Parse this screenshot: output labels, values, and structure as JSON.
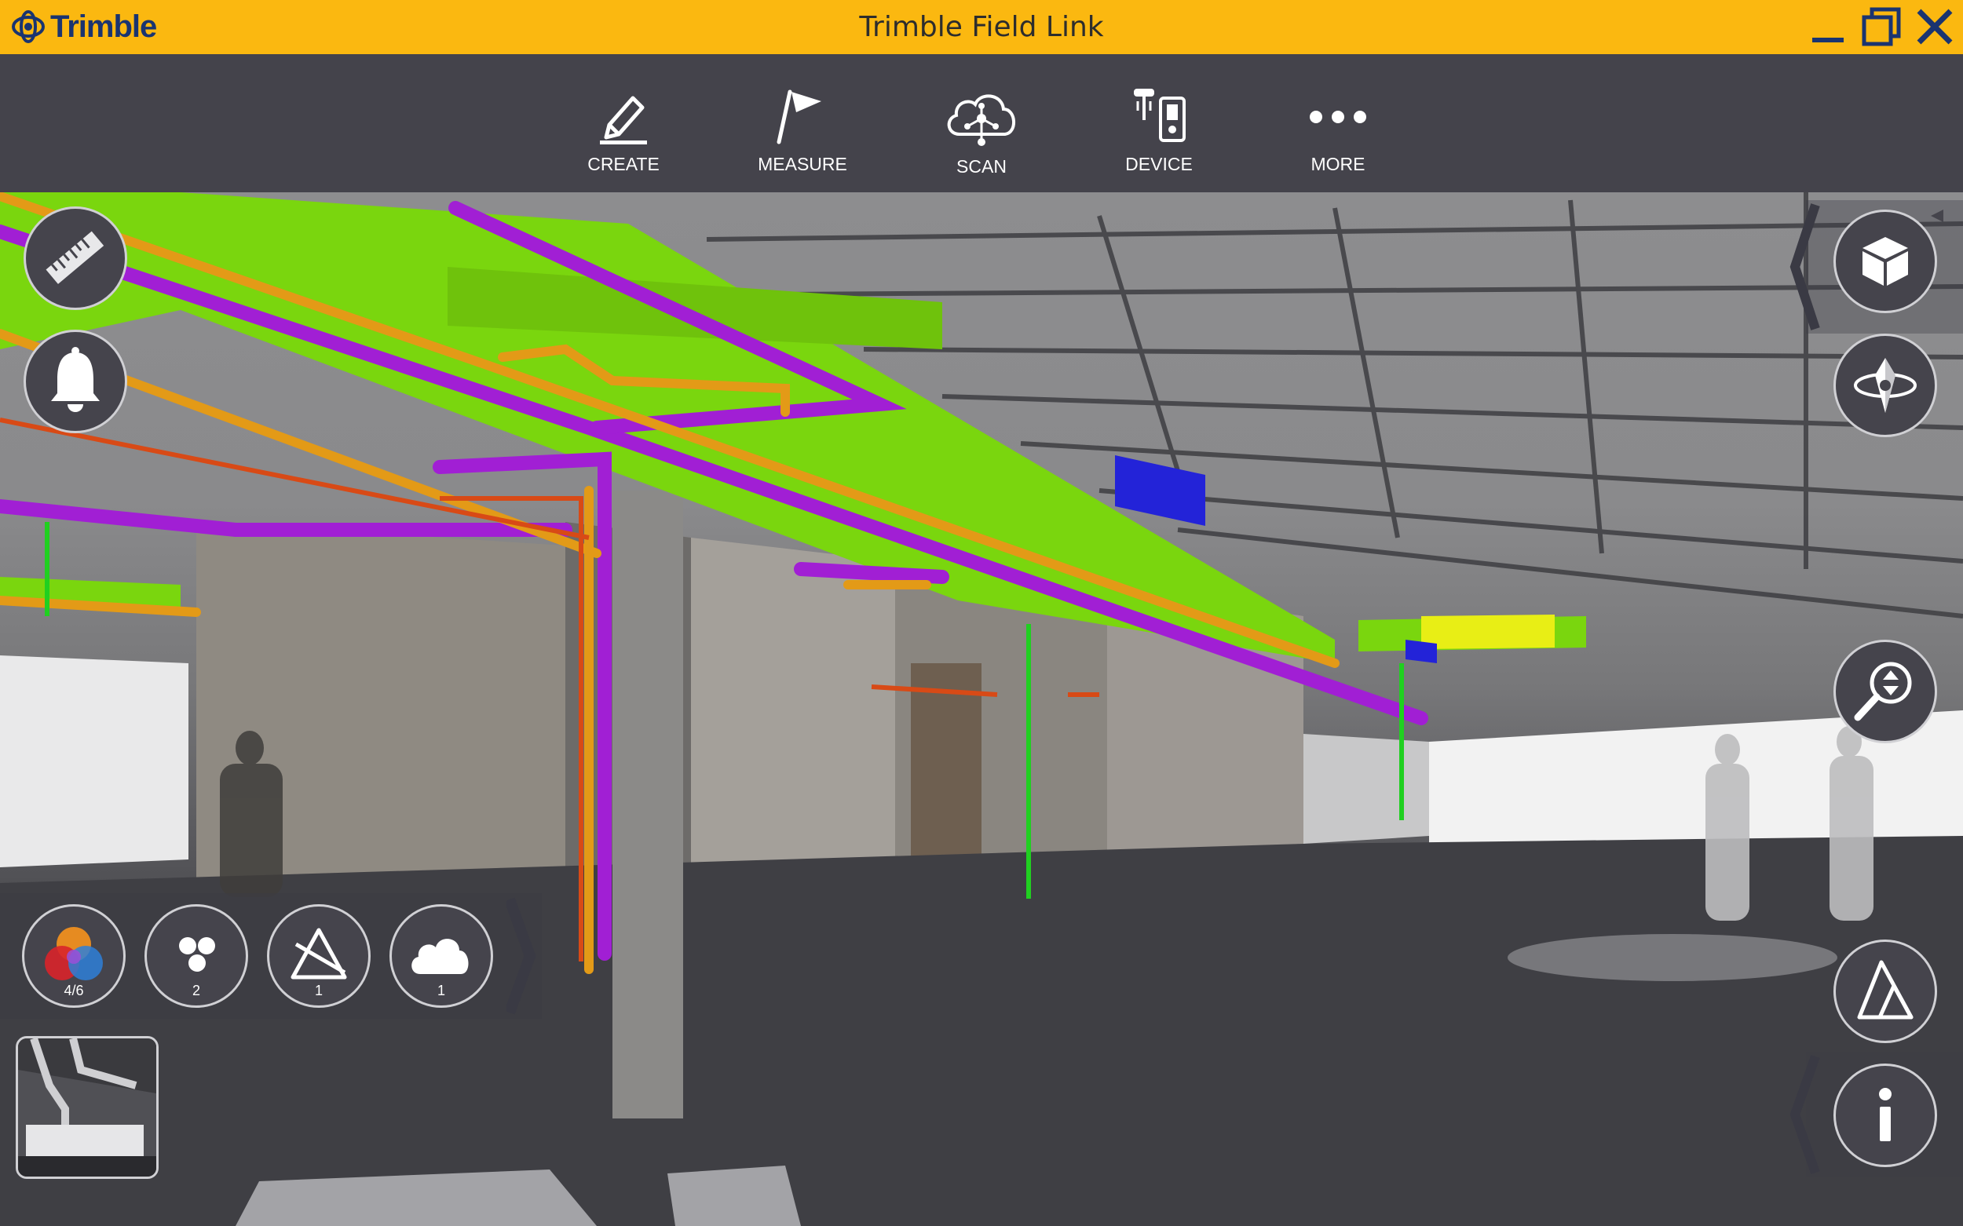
{
  "window": {
    "title": "Trimble Field Link",
    "logo_text": "Trimble",
    "controls": [
      "minimize",
      "maximize",
      "close"
    ]
  },
  "toolbar": {
    "items": [
      {
        "id": "create",
        "label": "CREATE",
        "icon": "pencil-icon"
      },
      {
        "id": "measure",
        "label": "MEASURE",
        "icon": "flag-icon"
      },
      {
        "id": "scan",
        "label": "SCAN",
        "icon": "cloud-network-icon"
      },
      {
        "id": "device",
        "label": "DEVICE",
        "icon": "instrument-icon"
      },
      {
        "id": "more",
        "label": "MORE",
        "icon": "ellipsis-icon"
      }
    ]
  },
  "left_tools": [
    {
      "id": "ruler",
      "icon": "ruler-icon"
    },
    {
      "id": "alerts",
      "icon": "bell-icon"
    }
  ],
  "layers": [
    {
      "id": "colors",
      "icon": "color-wheel-icon",
      "count": "4/6"
    },
    {
      "id": "points",
      "icon": "points-icon",
      "count": "2"
    },
    {
      "id": "hidden-geometry",
      "icon": "triangle-slash-icon",
      "count": "1"
    },
    {
      "id": "clouds",
      "icon": "cloud-icon",
      "count": "1"
    }
  ],
  "right_tools": [
    {
      "id": "view-cube",
      "icon": "cube-icon"
    },
    {
      "id": "orbit",
      "icon": "orbit-icon"
    },
    {
      "id": "zoom",
      "icon": "zoom-icon"
    },
    {
      "id": "surface",
      "icon": "triangles-icon"
    },
    {
      "id": "info",
      "icon": "info-icon"
    }
  ],
  "colors": {
    "titlebar": "#fbb810",
    "toolbar": "#44434b",
    "duct_green": "#7ad60e",
    "pipe_purple": "#a11fd4",
    "pipe_orange": "#e39a17"
  }
}
